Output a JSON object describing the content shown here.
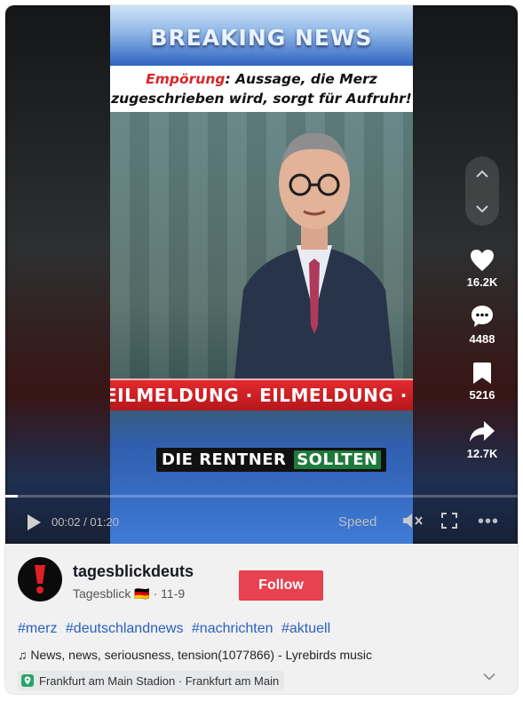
{
  "video": {
    "banner": "BREAKING NEWS",
    "headline_accent": "Empörung",
    "headline_rest": ": Aussage, die Merz",
    "headline_line2": "zugeschrieben wird, sorgt für Aufruhr!",
    "ticker": "EILMELDUNG · EILMELDUNG · EILMELDUNG · EI",
    "caption_main": "DIE RENTNER",
    "caption_highlight": "SOLLTEN"
  },
  "actions": {
    "likes": "16.2K",
    "comments": "4488",
    "saves": "5216",
    "shares": "12.7K"
  },
  "player": {
    "time": "00:02 / 01:20",
    "speed_label": "Speed",
    "progress": 0.025
  },
  "author": {
    "username": "tagesblickdeuts",
    "display_name": "Tagesblick 🇩🇪",
    "date": "11-9",
    "follow_label": "Follow"
  },
  "hashtags": [
    "#merz",
    "#deutschlandnews",
    "#nachrichten",
    "#aktuell"
  ],
  "music": "News, news, seriousness, tension(1077866) - Lyrebirds music",
  "location": "Frankfurt am Main Stadion · Frankfurt am Main",
  "colors": {
    "follow": "#e8414f",
    "hashtag": "#2b5fbd",
    "ticker": "#d8262a"
  }
}
